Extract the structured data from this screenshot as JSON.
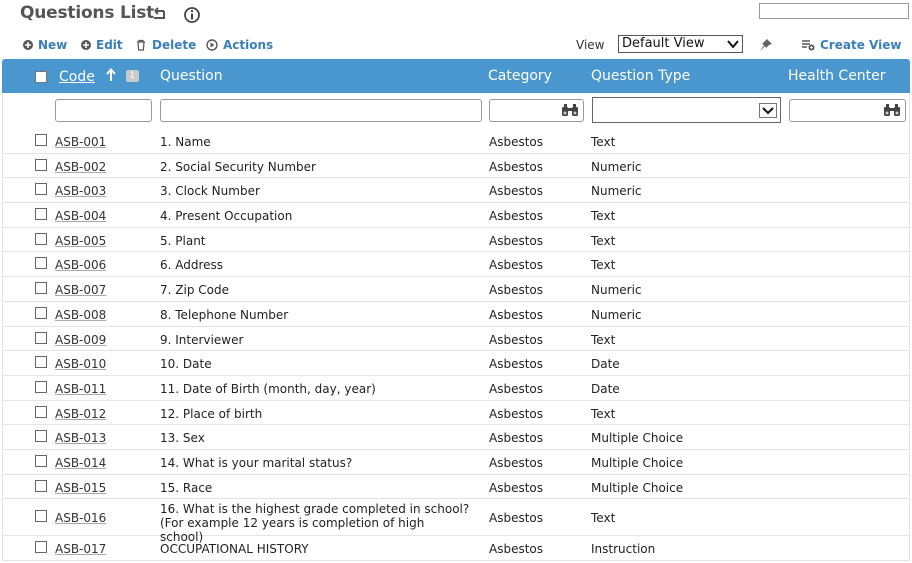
{
  "header": {
    "title": "Questions List"
  },
  "toolbar": {
    "new_label": "New",
    "edit_label": "Edit",
    "delete_label": "Delete",
    "actions_label": "Actions",
    "view_label": "View",
    "view_value": "Default View",
    "create_view_label": "Create View"
  },
  "colors": {
    "header_bg": "#4a97cf",
    "link": "#3a7fb8"
  },
  "grid": {
    "columns": {
      "code": "Code",
      "sort_index": "1",
      "question": "Question",
      "category": "Category",
      "question_type": "Question Type",
      "health_center": "Health Center"
    },
    "rows": [
      {
        "code": "ASB-001",
        "question": "1. Name",
        "category": "Asbestos",
        "type": "Text"
      },
      {
        "code": "ASB-002",
        "question": "2. Social Security Number",
        "category": "Asbestos",
        "type": "Numeric"
      },
      {
        "code": "ASB-003",
        "question": "3. Clock Number",
        "category": "Asbestos",
        "type": "Numeric"
      },
      {
        "code": "ASB-004",
        "question": "4. Present Occupation",
        "category": "Asbestos",
        "type": "Text"
      },
      {
        "code": "ASB-005",
        "question": "5. Plant",
        "category": "Asbestos",
        "type": "Text"
      },
      {
        "code": "ASB-006",
        "question": "6. Address",
        "category": "Asbestos",
        "type": "Text"
      },
      {
        "code": "ASB-007",
        "question": "7. Zip Code",
        "category": "Asbestos",
        "type": "Numeric"
      },
      {
        "code": "ASB-008",
        "question": "8. Telephone Number",
        "category": "Asbestos",
        "type": "Numeric"
      },
      {
        "code": "ASB-009",
        "question": "9. Interviewer",
        "category": "Asbestos",
        "type": "Text"
      },
      {
        "code": "ASB-010",
        "question": "10. Date",
        "category": "Asbestos",
        "type": "Date"
      },
      {
        "code": "ASB-011",
        "question": "11. Date of Birth (month, day, year)",
        "category": "Asbestos",
        "type": "Date"
      },
      {
        "code": "ASB-012",
        "question": "12. Place of birth",
        "category": "Asbestos",
        "type": "Text"
      },
      {
        "code": "ASB-013",
        "question": "13. Sex",
        "category": "Asbestos",
        "type": "Multiple Choice"
      },
      {
        "code": "ASB-014",
        "question": "14. What is your marital status?",
        "category": "Asbestos",
        "type": "Multiple Choice"
      },
      {
        "code": "ASB-015",
        "question": "15. Race",
        "category": "Asbestos",
        "type": "Multiple Choice"
      },
      {
        "code": "ASB-016",
        "question": "16. What is the highest grade completed in school? (For example 12 years is completion of high school)",
        "category": "Asbestos",
        "type": "Text"
      },
      {
        "code": "ASB-017",
        "question": "OCCUPATIONAL HISTORY",
        "category": "Asbestos",
        "type": "Instruction"
      }
    ]
  }
}
